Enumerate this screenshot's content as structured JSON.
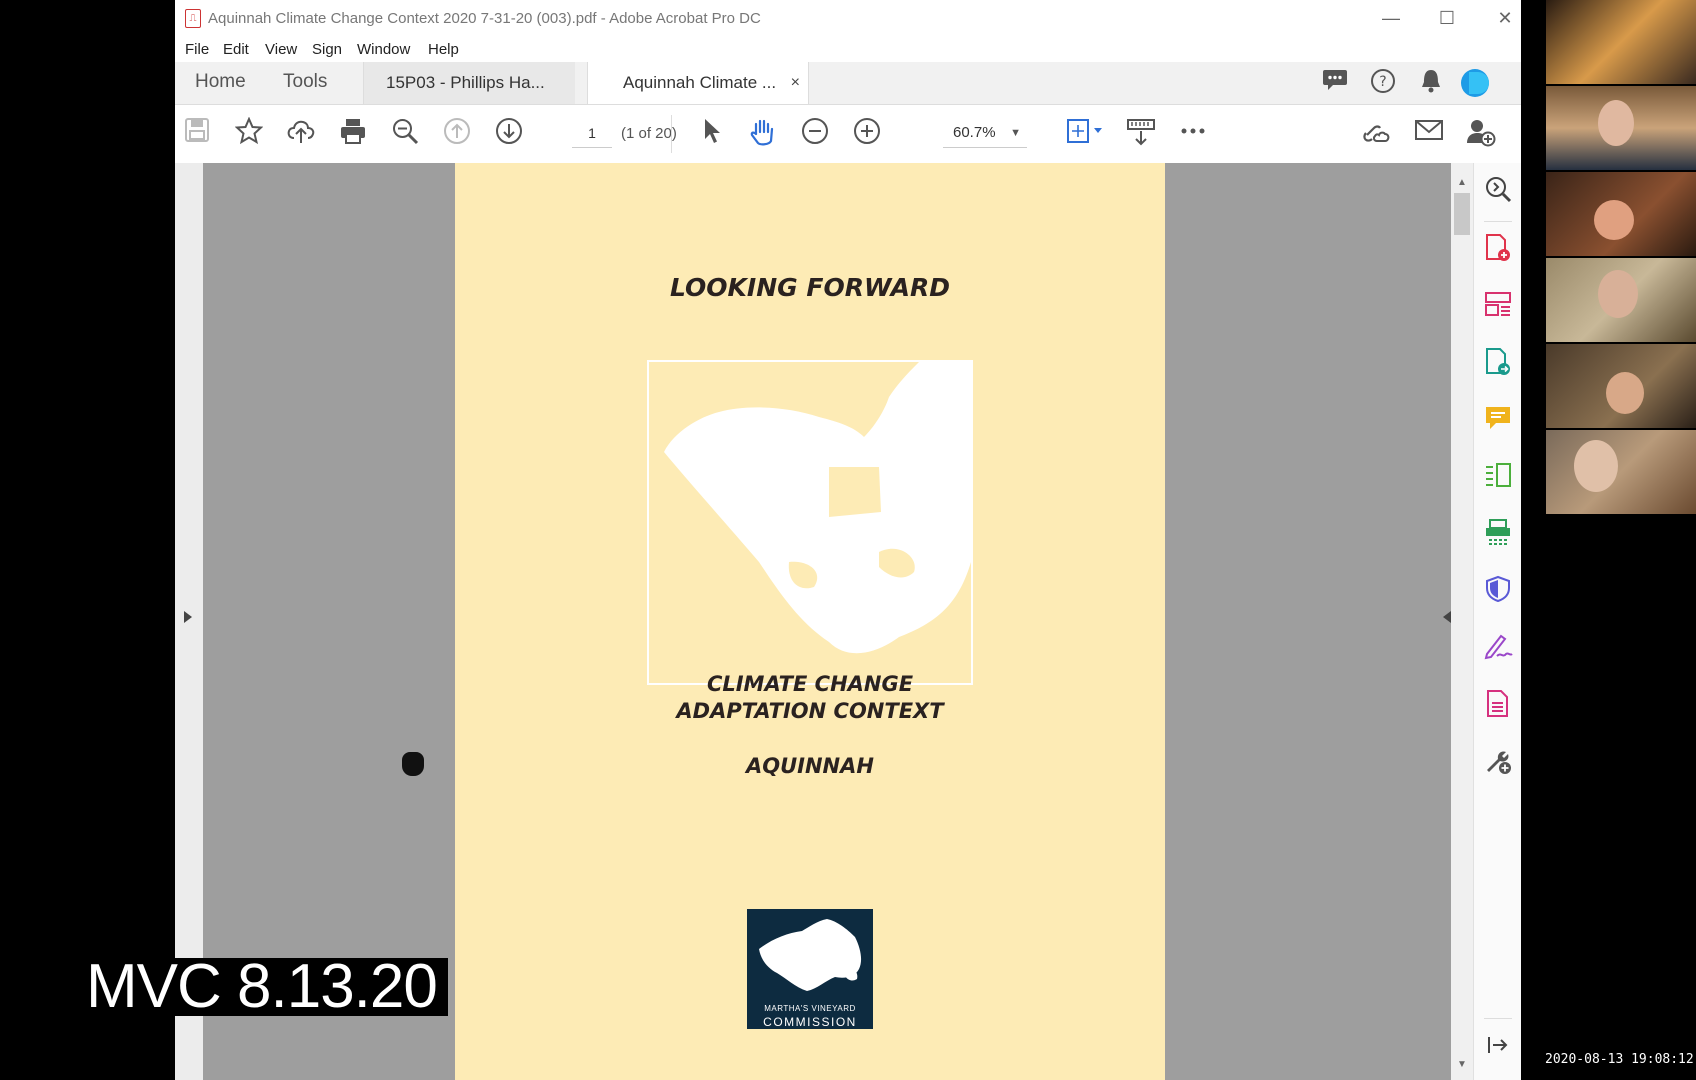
{
  "window": {
    "title": "Aquinnah Climate Change Context 2020 7-31-20 (003).pdf - Adobe Acrobat Pro DC",
    "controls": {
      "minimize": "—",
      "maximize": "☐",
      "close": "✕"
    }
  },
  "menu": [
    "File",
    "Edit",
    "View",
    "Sign",
    "Window",
    "Help"
  ],
  "nav": {
    "home": "Home",
    "tools": "Tools"
  },
  "tabs": [
    {
      "label": "15P03 - Phillips Ha..."
    },
    {
      "label": "Aquinnah Climate ...",
      "close": "×"
    }
  ],
  "toolbar": {
    "page_number": "1",
    "page_count": "(1 of 20)",
    "zoom": "60.7%"
  },
  "document": {
    "heading": "LOOKING FORWARD",
    "title_line1": "CLIMATE CHANGE",
    "title_line2": "ADAPTATION CONTEXT",
    "town": "AQUINNAH",
    "logo_line1": "MARTHA'S VINEYARD",
    "logo_line2": "COMMISSION"
  },
  "overlay": {
    "watermark": "MVC 8.13.20",
    "timestamp": "2020-08-13 19:08:12"
  },
  "icons": {
    "toolbar": [
      "save-icon",
      "bookmark-star-icon",
      "cloud-upload-icon",
      "print-icon",
      "zoom-search-icon",
      "prev-page-icon",
      "next-page-icon",
      "select-cursor-icon",
      "hand-tool-icon",
      "zoom-out-icon",
      "zoom-in-icon",
      "fit-page-icon",
      "scroll-mode-icon",
      "more-icon",
      "share-link-icon",
      "email-icon",
      "add-user-icon"
    ],
    "rightpanel": [
      "zoom-icon",
      "create-pdf-icon",
      "organize-pages-icon",
      "export-pdf-icon",
      "comment-icon",
      "compare-icon",
      "scan-icon",
      "protect-icon",
      "fill-sign-icon",
      "edit-pdf-icon",
      "more-tools-icon"
    ]
  },
  "colors": {
    "page": "#fdebb5",
    "logo": "#0d2b40",
    "accent": "#2f6fd6"
  }
}
